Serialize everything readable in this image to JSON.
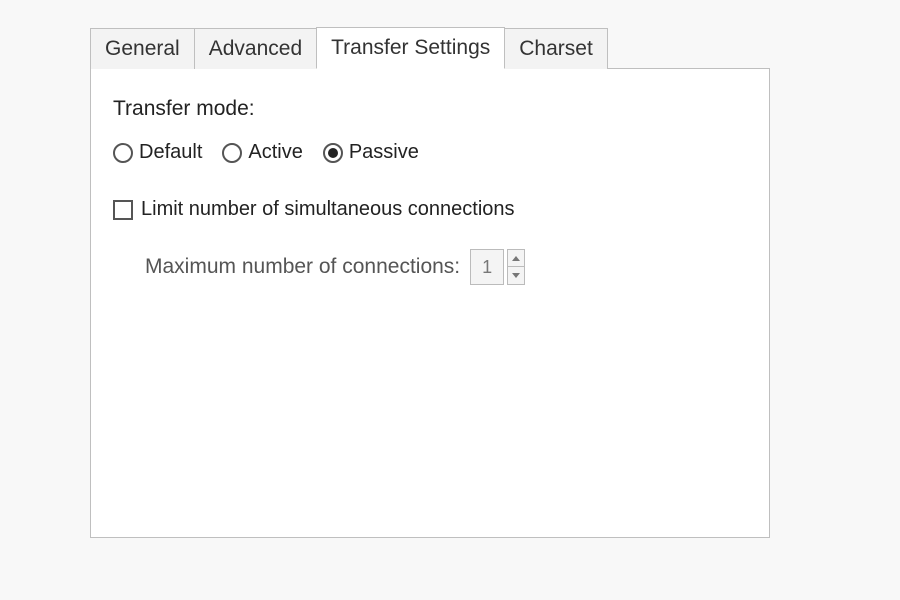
{
  "tabs": {
    "general": "General",
    "advanced": "Advanced",
    "transfer_settings": "Transfer Settings",
    "charset": "Charset"
  },
  "transfer": {
    "mode_label": "Transfer mode:",
    "options": {
      "default": "Default",
      "active": "Active",
      "passive": "Passive"
    },
    "selected": "passive",
    "limit_label": "Limit number of simultaneous connections",
    "limit_checked": false,
    "max_label": "Maximum number of connections:",
    "max_value": "1"
  }
}
